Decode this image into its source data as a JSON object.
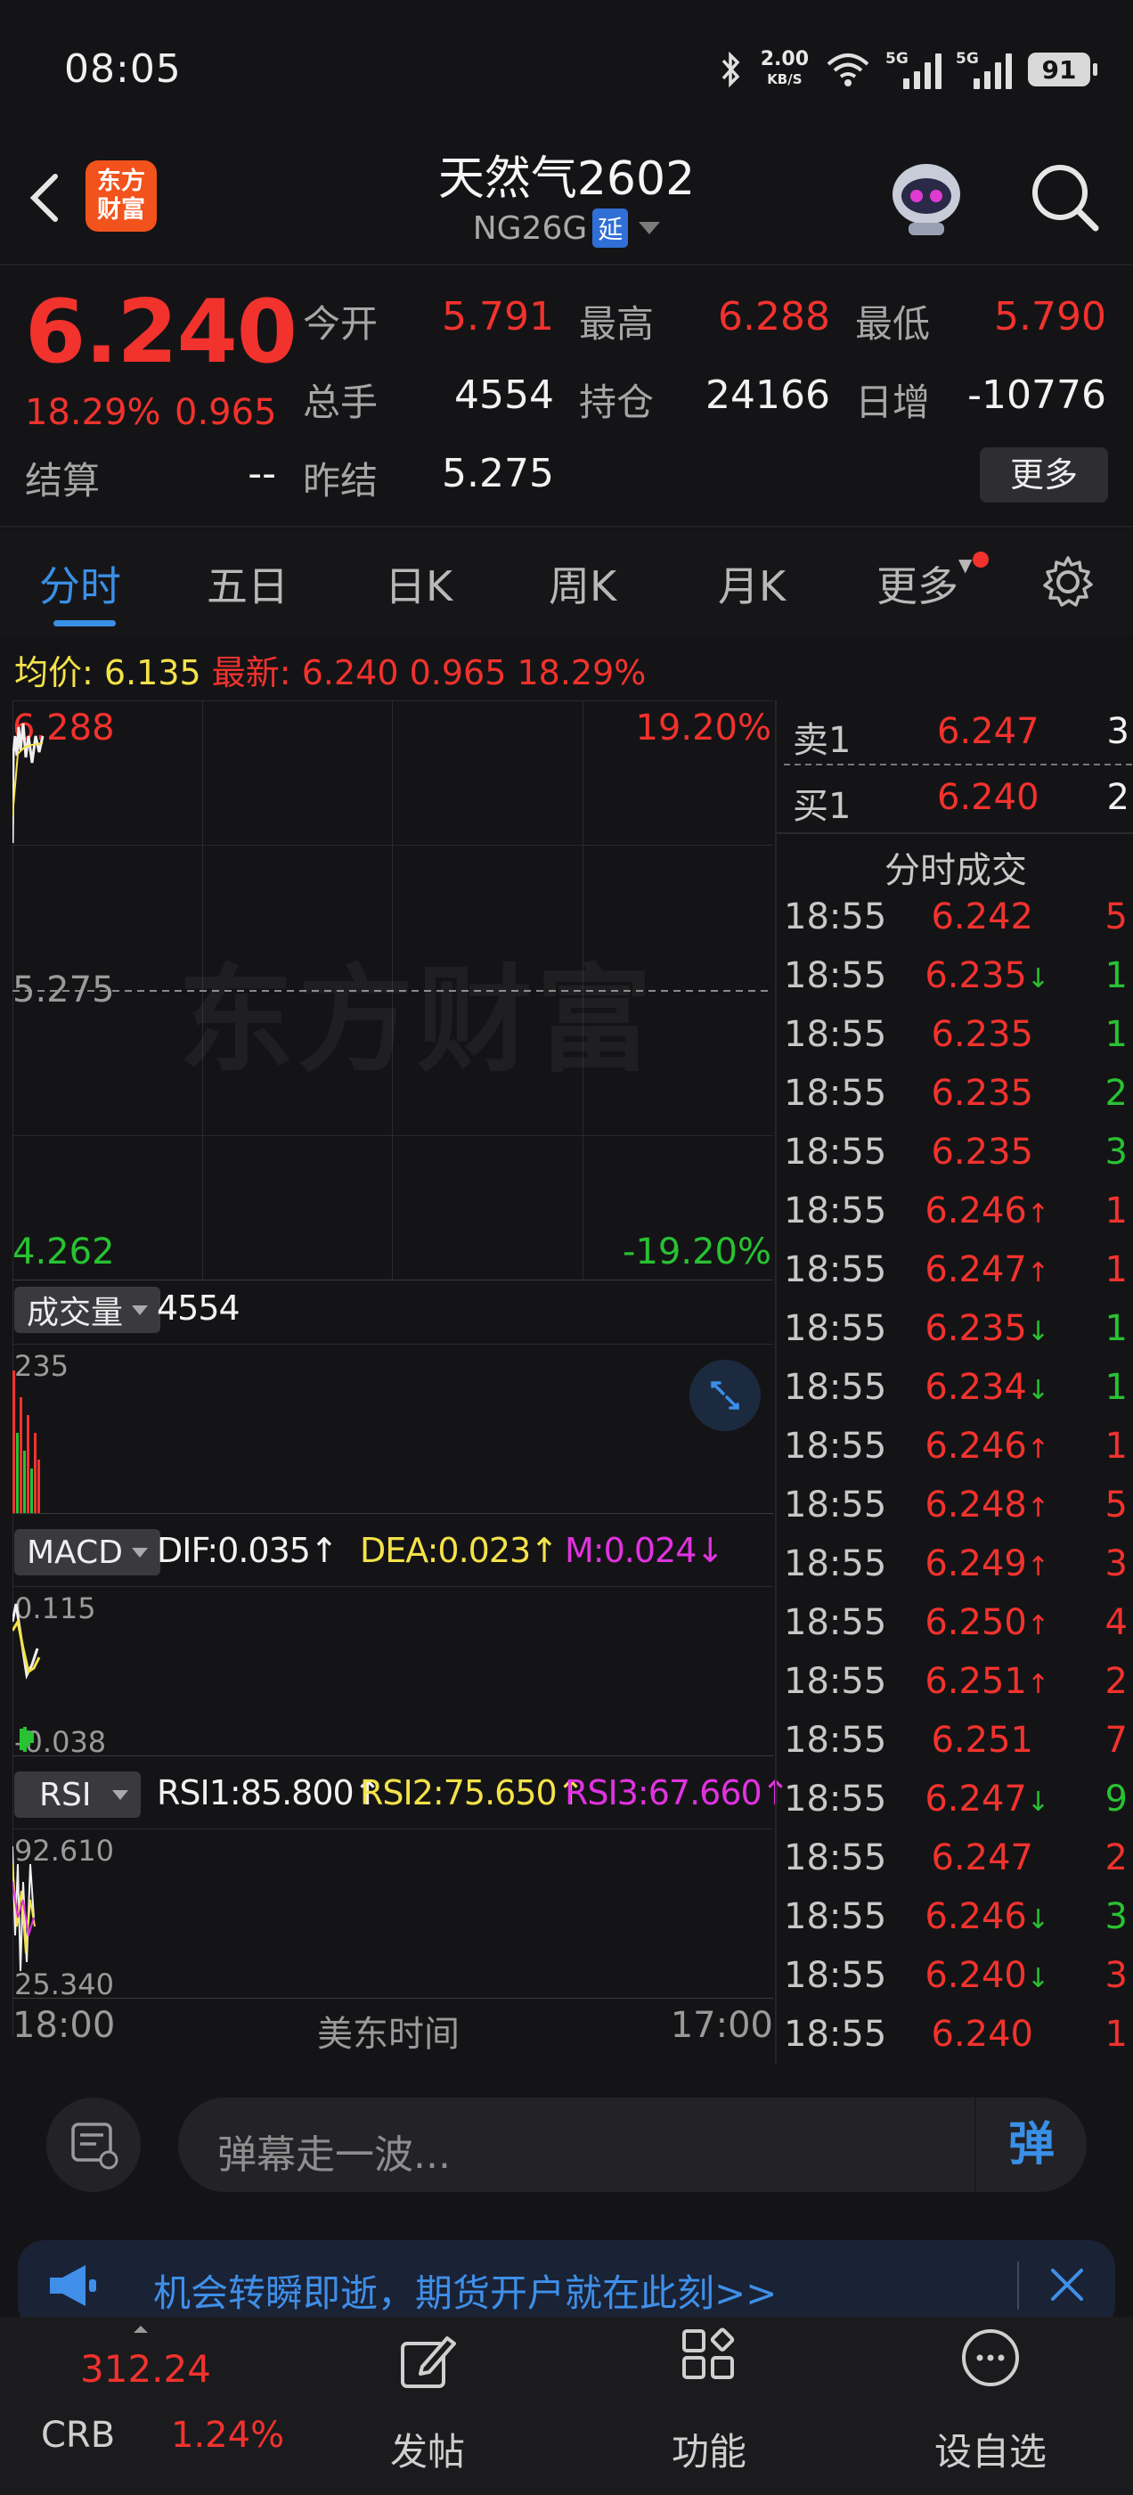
{
  "status_bar": {
    "time": "08:05",
    "net_speed_value": "2.00",
    "net_speed_unit": "KB/S",
    "signal_1_label": "5G",
    "signal_2_label": "5G",
    "battery": "91"
  },
  "header": {
    "logo_line1": "东方",
    "logo_line2": "财富",
    "title": "天然气2602",
    "subtitle": "NG26G",
    "delay_badge": "延"
  },
  "quote": {
    "last_price": "6.240",
    "change_pct": "18.29%",
    "change_amt": "0.965",
    "open_label": "今开",
    "open_value": "5.791",
    "high_label": "最高",
    "high_value": "6.288",
    "low_label": "最低",
    "low_value": "5.790",
    "volume_label": "总手",
    "volume_value": "4554",
    "oi_label": "持仓",
    "oi_value": "24166",
    "daily_inc_label": "日增",
    "daily_inc_value": "-10776",
    "settle_label": "结算",
    "settle_value": "--",
    "prev_settle_label": "昨结",
    "prev_settle_value": "5.275",
    "more_button": "更多"
  },
  "tabs": [
    "分时",
    "五日",
    "日K",
    "周K",
    "月K",
    "更多"
  ],
  "info_line": {
    "avg_label": "均价:",
    "avg_value": "6.135",
    "latest_label": "最新:",
    "latest_value": "6.240",
    "latest_chg": "0.965",
    "latest_pct": "18.29%"
  },
  "chart": {
    "top_price": "6.288",
    "top_pct": "19.20%",
    "mid_price": "5.275",
    "bottom_price": "4.262",
    "bottom_pct": "-19.20%",
    "watermark": "东方财富",
    "volume_selector": "成交量",
    "volume_total": "4554",
    "volume_max": "235",
    "macd_selector": "MACD",
    "macd_dif": "DIF:0.035↑",
    "macd_dea": "DEA:0.023↑",
    "macd_m": "M:0.024↓",
    "macd_top": "0.115",
    "macd_bottom": "-0.038",
    "rsi_selector": "RSI",
    "rsi1": "RSI1:85.800↑",
    "rsi2": "RSI2:75.650↑",
    "rsi3": "RSI3:67.660↑",
    "rsi_top": "92.610",
    "rsi_bottom": "25.340",
    "time_start": "18:00",
    "time_zone": "美东时间",
    "time_end": "17:00"
  },
  "order_book": {
    "ask_label": "卖1",
    "ask_price": "6.247",
    "ask_vol": "3",
    "bid_label": "买1",
    "bid_price": "6.240",
    "bid_vol": "2",
    "ticks_title": "分时成交"
  },
  "trades": [
    {
      "time": "18:55",
      "price": "6.242",
      "arrow": "",
      "vol": "5",
      "price_color": "red",
      "vol_color": "red"
    },
    {
      "time": "18:55",
      "price": "6.235",
      "arrow": "↓",
      "vol": "1",
      "price_color": "red",
      "vol_color": "green"
    },
    {
      "time": "18:55",
      "price": "6.235",
      "arrow": "",
      "vol": "1",
      "price_color": "red",
      "vol_color": "green"
    },
    {
      "time": "18:55",
      "price": "6.235",
      "arrow": "",
      "vol": "2",
      "price_color": "red",
      "vol_color": "green"
    },
    {
      "time": "18:55",
      "price": "6.235",
      "arrow": "",
      "vol": "3",
      "price_color": "red",
      "vol_color": "green"
    },
    {
      "time": "18:55",
      "price": "6.246",
      "arrow": "↑",
      "vol": "1",
      "price_color": "red",
      "vol_color": "red"
    },
    {
      "time": "18:55",
      "price": "6.247",
      "arrow": "↑",
      "vol": "1",
      "price_color": "red",
      "vol_color": "red"
    },
    {
      "time": "18:55",
      "price": "6.235",
      "arrow": "↓",
      "vol": "1",
      "price_color": "red",
      "vol_color": "green"
    },
    {
      "time": "18:55",
      "price": "6.234",
      "arrow": "↓",
      "vol": "1",
      "price_color": "red",
      "vol_color": "green"
    },
    {
      "time": "18:55",
      "price": "6.246",
      "arrow": "↑",
      "vol": "1",
      "price_color": "red",
      "vol_color": "red"
    },
    {
      "time": "18:55",
      "price": "6.248",
      "arrow": "↑",
      "vol": "5",
      "price_color": "red",
      "vol_color": "red"
    },
    {
      "time": "18:55",
      "price": "6.249",
      "arrow": "↑",
      "vol": "3",
      "price_color": "red",
      "vol_color": "red"
    },
    {
      "time": "18:55",
      "price": "6.250",
      "arrow": "↑",
      "vol": "4",
      "price_color": "red",
      "vol_color": "red"
    },
    {
      "time": "18:55",
      "price": "6.251",
      "arrow": "↑",
      "vol": "2",
      "price_color": "red",
      "vol_color": "red"
    },
    {
      "time": "18:55",
      "price": "6.251",
      "arrow": "",
      "vol": "7",
      "price_color": "red",
      "vol_color": "red"
    },
    {
      "time": "18:55",
      "price": "6.247",
      "arrow": "↓",
      "vol": "9",
      "price_color": "red",
      "vol_color": "green"
    },
    {
      "time": "18:55",
      "price": "6.247",
      "arrow": "",
      "vol": "2",
      "price_color": "red",
      "vol_color": "red"
    },
    {
      "time": "18:55",
      "price": "6.246",
      "arrow": "↓",
      "vol": "3",
      "price_color": "red",
      "vol_color": "green"
    },
    {
      "time": "18:55",
      "price": "6.240",
      "arrow": "↓",
      "vol": "3",
      "price_color": "red",
      "vol_color": "red"
    },
    {
      "time": "18:55",
      "price": "6.240",
      "arrow": "",
      "vol": "1",
      "price_color": "red",
      "vol_color": "red"
    }
  ],
  "comment_bar": {
    "placeholder": "弹幕走一波...",
    "danmaku_label": "弹"
  },
  "banner": {
    "text": "机会转瞬即逝，期货开户就在此刻>>"
  },
  "bottom_nav": {
    "crb_value": "312.24",
    "crb_label": "CRB",
    "crb_pct": "1.24%",
    "post_label": "发帖",
    "function_label": "功能",
    "watchlist_label": "设自选"
  },
  "colors": {
    "up": "#f2322d",
    "down": "#28c232",
    "accent": "#3a8fe6",
    "avg_line": "#f4e24a",
    "background": "#141416"
  }
}
